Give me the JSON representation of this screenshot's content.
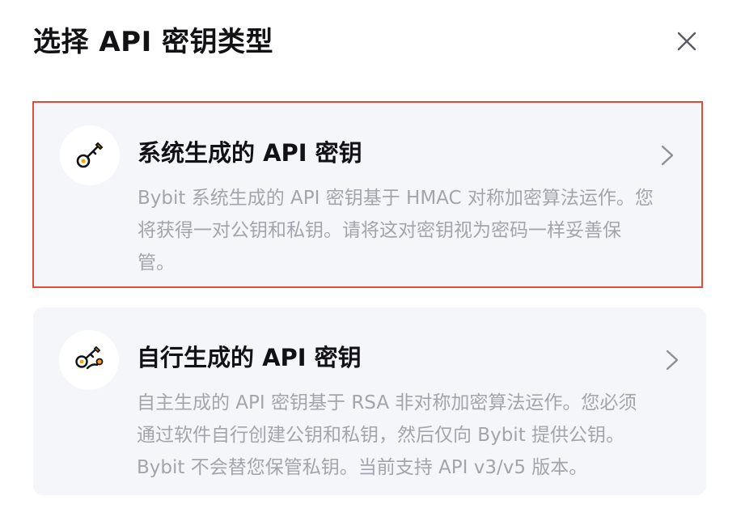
{
  "dialog": {
    "title": "选择 API 密钥类型"
  },
  "options": [
    {
      "title": "系统生成的 API 密钥",
      "description": "Bybit 系统生成的 API 密钥基于 HMAC 对称加密算法运作。您将获得一对公钥和私钥。请将这对密钥视为密码一样妥善保管。",
      "icon": "key-icon",
      "selected": true
    },
    {
      "title": "自行生成的 API 密钥",
      "description": "自主生成的 API 密钥基于 RSA 非对称加密算法运作。您必须通过软件自行创建公钥和私钥，然后仅向 Bybit 提供公钥。Bybit 不会替您保管私钥。当前支持 API v3/v5 版本。",
      "icon": "key-pair-icon",
      "selected": false
    }
  ],
  "colors": {
    "accent": "#f7a600",
    "selected_border": "#e24b36",
    "card_bg": "#f5f6fa",
    "muted_text": "#a3a4ad"
  }
}
